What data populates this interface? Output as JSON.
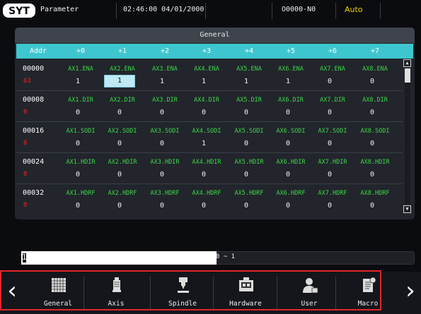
{
  "topbar": {
    "screen_title": "Parameter",
    "datetime": "02:46:00 04/01/2000",
    "program": "O0000-N0",
    "mode": "Auto"
  },
  "panel": {
    "title": "General",
    "columns": [
      "Addr",
      "+0",
      "+1",
      "+2",
      "+3",
      "+4",
      "+5",
      "+6",
      "+7"
    ],
    "groups": [
      {
        "addr": "00000",
        "value": "63",
        "names": [
          "AX1.ENA",
          "AX2.ENA",
          "AX3.ENA",
          "AX4.ENA",
          "AX5.ENA",
          "AX6.ENA",
          "AX7.ENA",
          "AX8.ENA"
        ],
        "values": [
          "1",
          "1",
          "1",
          "1",
          "1",
          "1",
          "0",
          "0"
        ]
      },
      {
        "addr": "00008",
        "value": "0",
        "names": [
          "AX1.DIR",
          "AX2.DIR",
          "AX3.DIR",
          "AX4.DIR",
          "AX5.DIR",
          "AX6.DIR",
          "AX7.DIR",
          "AX8.DIR"
        ],
        "values": [
          "0",
          "0",
          "0",
          "0",
          "0",
          "0",
          "0",
          "0"
        ]
      },
      {
        "addr": "00016",
        "value": "8",
        "names": [
          "AX1.SODI",
          "AX2.SODI",
          "AX3.SODI",
          "AX4.SODI",
          "AX5.SODI",
          "AX6.SODI",
          "AX7.SODI",
          "AX8.SODI"
        ],
        "values": [
          "0",
          "0",
          "0",
          "1",
          "0",
          "0",
          "0",
          "0"
        ]
      },
      {
        "addr": "00024",
        "value": "0",
        "names": [
          "AX1.HDIR",
          "AX2.HDIR",
          "AX3.HDIR",
          "AX4.HDIR",
          "AX5.HDIR",
          "AX6.HDIR",
          "AX7.HDIR",
          "AX8.HDIR"
        ],
        "values": [
          "0",
          "0",
          "0",
          "0",
          "0",
          "0",
          "0",
          "0"
        ]
      },
      {
        "addr": "00032",
        "value": "0",
        "names": [
          "AX1.HDRF",
          "AX2.HDRF",
          "AX3.HDRF",
          "AX4.HDRF",
          "AX5.HDRF",
          "AX6.HDRF",
          "AX7.HDRF",
          "AX8.HDRF"
        ],
        "values": [
          "0",
          "0",
          "0",
          "0",
          "0",
          "0",
          "0",
          "0"
        ]
      }
    ],
    "selected": {
      "group": 0,
      "col": 1
    }
  },
  "input": {
    "value": "1",
    "range": "0 ~ 1"
  },
  "softkeys": [
    {
      "label": "General",
      "icon": "grid-icon"
    },
    {
      "label": "Axis",
      "icon": "motor-icon"
    },
    {
      "label": "Spindle",
      "icon": "spindle-icon"
    },
    {
      "label": "Hardware",
      "icon": "hardware-icon"
    },
    {
      "label": "User",
      "icon": "user-icon"
    },
    {
      "label": "Macro",
      "icon": "macro-icon"
    }
  ],
  "colors": {
    "header": "#3ec6cf",
    "param_name": "#3fd64a",
    "addr_value": "#e8262b",
    "mode": "#f0d000",
    "highlight_box": "#e2262b"
  }
}
